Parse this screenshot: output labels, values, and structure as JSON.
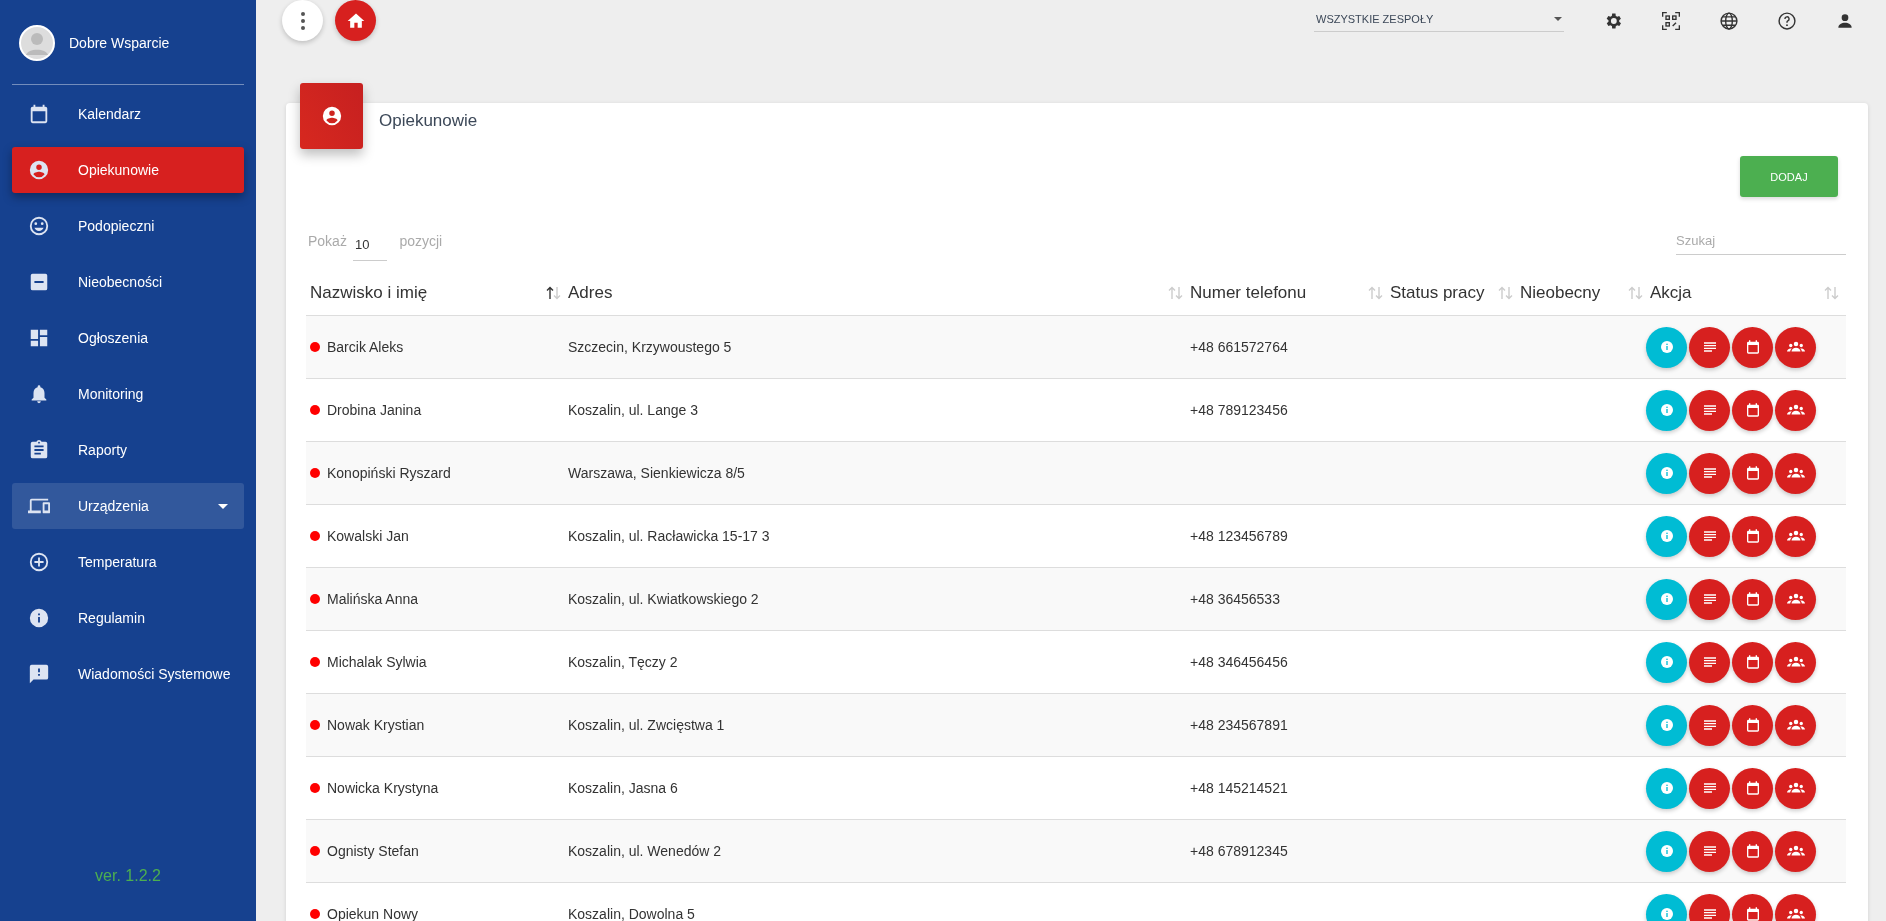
{
  "sidebar": {
    "user": "Dobre Wsparcie",
    "items": [
      {
        "label": "Kalendarz",
        "selected": false,
        "kind": "link"
      },
      {
        "label": "Opiekunowie",
        "selected": true,
        "kind": "link"
      },
      {
        "label": "Podopieczni",
        "selected": false,
        "kind": "link"
      },
      {
        "label": "Nieobecności",
        "selected": false,
        "kind": "link"
      },
      {
        "label": "Ogłoszenia",
        "selected": false,
        "kind": "link"
      },
      {
        "label": "Monitoring",
        "selected": false,
        "kind": "link"
      },
      {
        "label": "Raporty",
        "selected": false,
        "kind": "link"
      },
      {
        "label": "Urządzenia",
        "selected": false,
        "kind": "group"
      },
      {
        "label": "Temperatura",
        "selected": false,
        "kind": "link"
      },
      {
        "label": "Regulamin",
        "selected": false,
        "kind": "link"
      },
      {
        "label": "Wiadomości Systemowe",
        "selected": false,
        "kind": "link"
      }
    ],
    "version": "ver. 1.2.2"
  },
  "topbar": {
    "team_select": "WSZYSTKIE ZESPOŁY"
  },
  "card": {
    "title": "Opiekunowie",
    "add_button": "DODAJ",
    "show_label": "Pokaż",
    "show_value": "10",
    "show_suffix": "pozycji",
    "search": {
      "placeholder": "Szukaj"
    },
    "columns": [
      {
        "label": "Nazwisko i imię",
        "sorted": true
      },
      {
        "label": "Adres",
        "sorted": false
      },
      {
        "label": "Numer telefonu",
        "sorted": false
      },
      {
        "label": "Status pracy",
        "sorted": false
      },
      {
        "label": "Nieobecny",
        "sorted": false
      },
      {
        "label": "Akcja",
        "sorted": false
      }
    ],
    "rows": [
      {
        "name": "Barcik Aleks",
        "address": "Szczecin, Krzywoustego 5",
        "phone": "+48 661572764",
        "color": "#ff0000"
      },
      {
        "name": "Drobina Janina",
        "address": "Koszalin, ul. Lange 3",
        "phone": "+48 789123456",
        "color": "#ff0000"
      },
      {
        "name": "Konopiński Ryszard",
        "address": "Warszawa, Sienkiewicza 8/5",
        "phone": "",
        "color": "#ff0000"
      },
      {
        "name": "Kowalski Jan",
        "address": "Koszalin, ul. Racławicka 15-17 3",
        "phone": "+48 123456789",
        "color": "#ff0000"
      },
      {
        "name": "Malińska Anna",
        "address": "Koszalin, ul. Kwiatkowskiego 2",
        "phone": "+48 36456533",
        "color": "#ff0000"
      },
      {
        "name": "Michalak Sylwia",
        "address": "Koszalin, Tęczy 2",
        "phone": "+48 346456456",
        "color": "#ff0000"
      },
      {
        "name": "Nowak Krystian",
        "address": "Koszalin, ul. Zwcięstwa 1",
        "phone": "+48 234567891",
        "color": "#ff0000"
      },
      {
        "name": "Nowicka Krystyna",
        "address": "Koszalin, Jasna 6",
        "phone": "+48 145214521",
        "color": "#ff0000"
      },
      {
        "name": "Ognisty Stefan",
        "address": "Koszalin, ul. Wenedów 2",
        "phone": "+48 678912345",
        "color": "#ff0000"
      },
      {
        "name": "Opiekun Nowy",
        "address": "Koszalin, Dowolna 5",
        "phone": "",
        "color": "#ff0000"
      }
    ]
  }
}
